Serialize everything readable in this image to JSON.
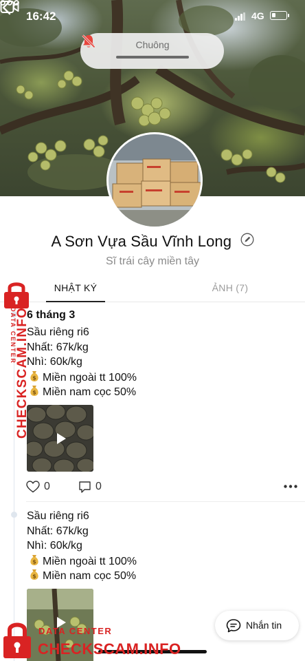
{
  "status_bar": {
    "time": "16:42",
    "network": "4G",
    "battery_level": 0.25
  },
  "header": {
    "back_icon": "chevron-left-icon",
    "mute_pill": {
      "label": "Chuông",
      "icon": "bell-off-icon",
      "icon_color": "#e8453c"
    },
    "video_icon": "video-camera-icon",
    "more_icon": "more-dots-icon"
  },
  "profile": {
    "name": "A Sơn Vựa Sầu Vĩnh Long",
    "edit_icon": "pencil-icon",
    "bio": "Sĩ trái cây miền tây"
  },
  "tabs": [
    {
      "label": "NHẬT KÝ",
      "active": true
    },
    {
      "label": "ẢNH (7)",
      "active": false
    }
  ],
  "posts": [
    {
      "date": "6 tháng 3",
      "lines": [
        "Sầu riêng ri6",
        "Nhất: 67k/kg",
        "Nhì: 60k/kg"
      ],
      "bag_lines": [
        "Miền ngoài tt 100%",
        "Miền nam cọc 50%"
      ],
      "media": "video",
      "likes": "0",
      "comments": "0"
    },
    {
      "date": "",
      "lines": [
        "Sầu riêng ri6",
        "Nhất: 67k/kg",
        "Nhì: 60k/kg"
      ],
      "bag_lines": [
        "Miền ngoài tt 100%",
        "Miền nam cọc 50%"
      ],
      "media": "video"
    }
  ],
  "message_button": {
    "label": "Nhắn tin",
    "icon": "chat-bubble-icon"
  },
  "watermark": {
    "vertical_big": "CHECKSCAM.INFO",
    "vertical_small": "DATA CENTER",
    "bottom_small": "DATA CENTER",
    "bottom_big": "CHECKSCAM.INFO",
    "color": "#d92323"
  },
  "colors": {
    "mute_icon_red": "#e8453c",
    "watermark_red": "#d92323",
    "timeline": "#dfe6ee"
  }
}
